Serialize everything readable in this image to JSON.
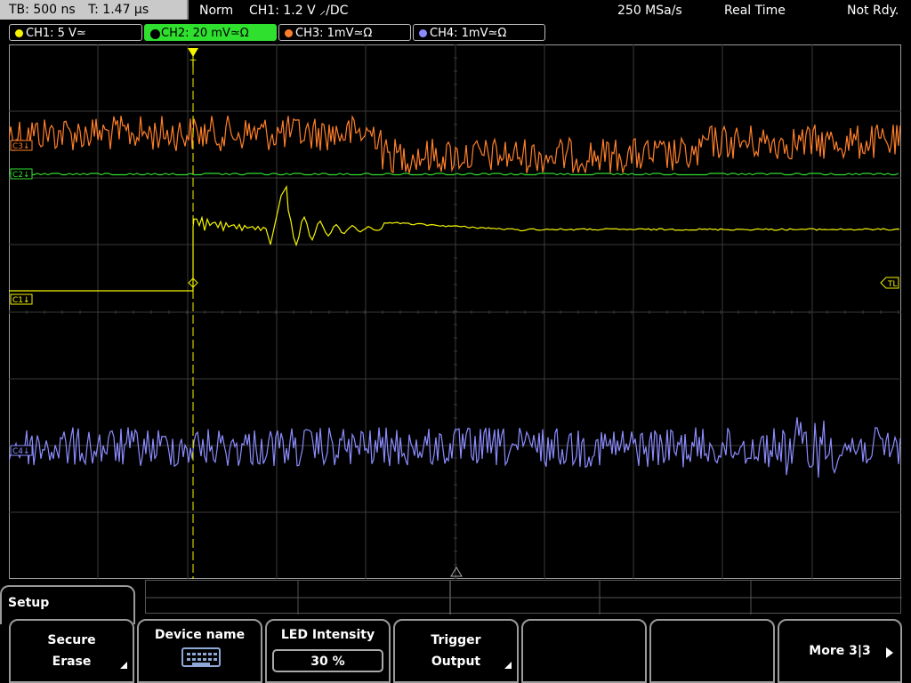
{
  "header": {
    "timebase": "TB: 500 ns",
    "trigger_time": "T: 1.47 µs",
    "trigger_mode": "Norm",
    "trigger_info": "CH1: 1.2 V ⸝/DC",
    "sample_rate": "250 MSa/s",
    "acq_mode": "Real Time",
    "status": "Not Rdy."
  },
  "channels": [
    {
      "label": "CH1: 5 V≃",
      "color": "#f5f500",
      "active": false
    },
    {
      "label": "CH2: 20 mV≃Ω",
      "color": "#2fe02f",
      "active": true
    },
    {
      "label": "CH3: 1mV≃Ω",
      "color": "#ff7f2a",
      "active": false
    },
    {
      "label": "CH4: 1mV≃Ω",
      "color": "#8c8cff",
      "active": false
    }
  ],
  "markers": {
    "c1": "C1↓",
    "c2": "C2↓",
    "c3": "C3↓",
    "c4": "C4↓",
    "tl": "TL",
    "trigger": "T"
  },
  "softkeys": {
    "menu_title": "Setup",
    "secure_erase_1": "Secure",
    "secure_erase_2": "Erase",
    "device_name": "Device name",
    "led_intensity": "LED Intensity",
    "led_value": "30 %",
    "trigger_output_1": "Trigger",
    "trigger_output_2": "Output",
    "more": "More 3|3"
  }
}
